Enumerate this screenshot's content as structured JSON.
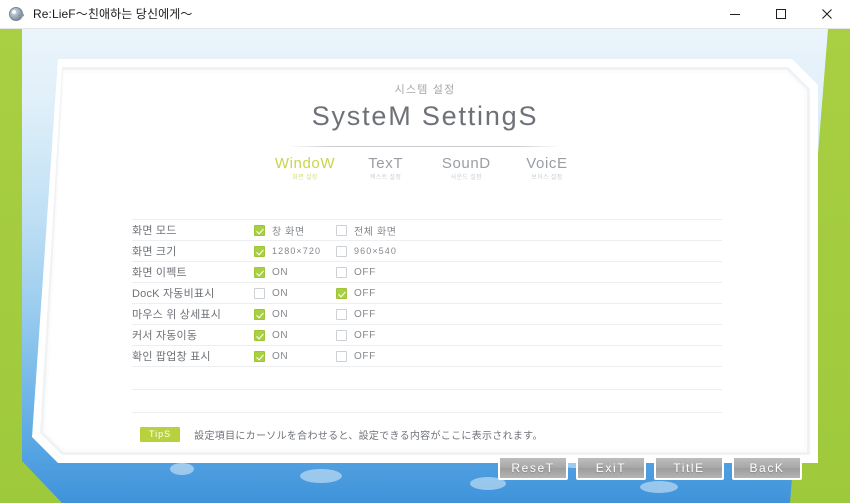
{
  "window": {
    "title": "Re:LieF～친애하는 당신에게～",
    "icon": "app-icon",
    "controls": {
      "minimize": "minimize-icon",
      "maximize": "maximize-icon",
      "close": "close-icon"
    }
  },
  "header": {
    "subtitle": "시스템 설정",
    "title": "SysteM SettingS"
  },
  "tabs": [
    {
      "name": "WindoW",
      "sub": "화면 설정",
      "active": true
    },
    {
      "name": "TexT",
      "sub": "텍스트 설정",
      "active": false
    },
    {
      "name": "SounD",
      "sub": "사운드 설정",
      "active": false
    },
    {
      "name": "VoicE",
      "sub": "보이스 설정",
      "active": false
    }
  ],
  "settings": [
    {
      "label": "화면 모드",
      "option_a": {
        "text": "창 화면",
        "checked": true
      },
      "option_b": {
        "text": "전체 화면",
        "checked": false
      }
    },
    {
      "label": "화면 크기",
      "option_a": {
        "text": "1280×720",
        "checked": true
      },
      "option_b": {
        "text": "960×540",
        "checked": false
      }
    },
    {
      "label": "화면 이펙트",
      "option_a": {
        "text": "ON",
        "checked": true
      },
      "option_b": {
        "text": "OFF",
        "checked": false
      }
    },
    {
      "label": "DocK 자동비표시",
      "option_a": {
        "text": "ON",
        "checked": false
      },
      "option_b": {
        "text": "OFF",
        "checked": true
      }
    },
    {
      "label": "마우스 위 상세표시",
      "option_a": {
        "text": "ON",
        "checked": true
      },
      "option_b": {
        "text": "OFF",
        "checked": false
      }
    },
    {
      "label": "커서 자동이동",
      "option_a": {
        "text": "ON",
        "checked": true
      },
      "option_b": {
        "text": "OFF",
        "checked": false
      }
    },
    {
      "label": "확인 팝업창 표시",
      "option_a": {
        "text": "ON",
        "checked": true
      },
      "option_b": {
        "text": "OFF",
        "checked": false
      }
    }
  ],
  "empty_rows": 2,
  "tips": {
    "badge": "TipS",
    "text": "設定項目にカーソルを合わせると、設定できる内容がここに表示されます。"
  },
  "footer_buttons": [
    {
      "label": "ReseT"
    },
    {
      "label": "ExiT"
    },
    {
      "label": "TitlE"
    },
    {
      "label": "BacK"
    }
  ],
  "colors": {
    "accent_green": "#a9cf42",
    "tab_active": "#c6d64a",
    "tips_badge": "#b8d23e",
    "title_gray": "#6e7278",
    "sky_top": "#eaf4fb",
    "sky_bottom": "#3f93da"
  }
}
